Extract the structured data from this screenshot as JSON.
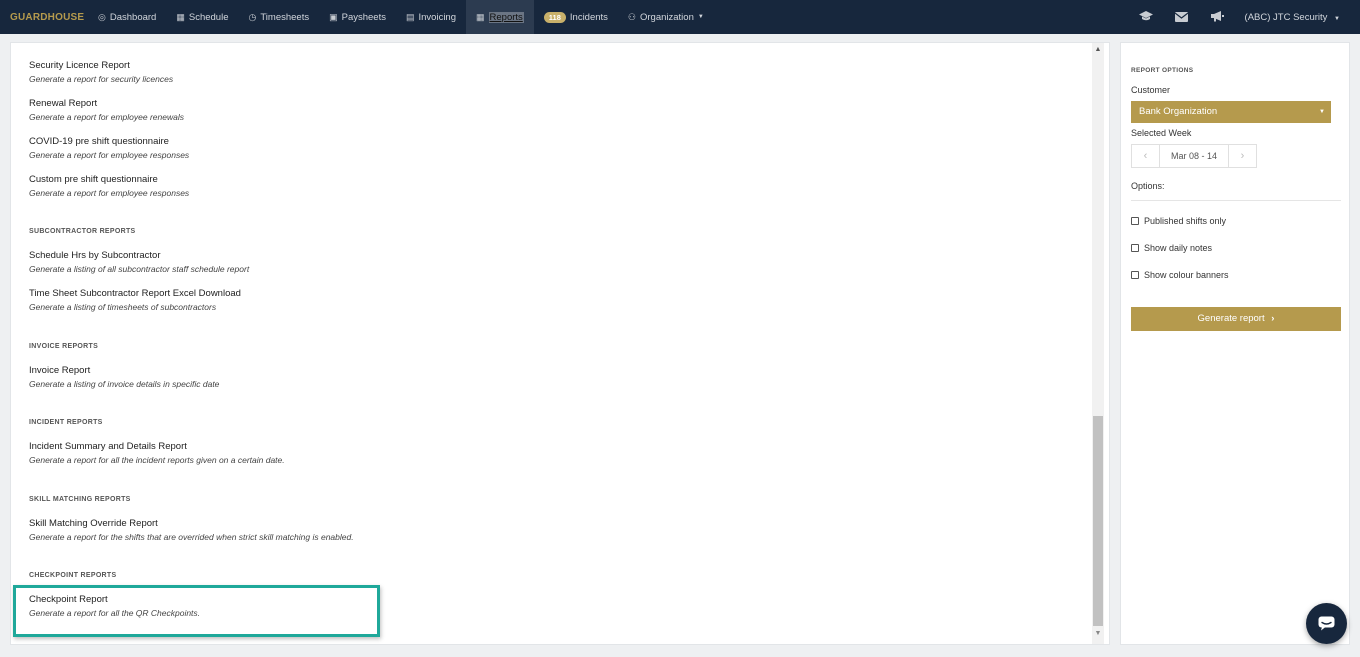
{
  "nav": {
    "brand": "GUARDHOUSE",
    "items": [
      {
        "label": "Dashboard",
        "icon": "dashboard-icon",
        "glyph": "◎"
      },
      {
        "label": "Schedule",
        "icon": "calendar-icon",
        "glyph": "▦"
      },
      {
        "label": "Timesheets",
        "icon": "clock-icon",
        "glyph": "◷"
      },
      {
        "label": "Paysheets",
        "icon": "money-icon",
        "glyph": "▣"
      },
      {
        "label": "Invoicing",
        "icon": "invoice-icon",
        "glyph": "▤"
      },
      {
        "label": "Reports",
        "icon": "table-icon",
        "glyph": "▦"
      },
      {
        "label": "Incidents",
        "badge": "118"
      },
      {
        "label": "Organization",
        "icon": "users-icon",
        "glyph": "⚇"
      }
    ],
    "right": {
      "icons": [
        "graduation-cap-icon",
        "envelope-icon",
        "megaphone-icon"
      ],
      "account": "(ABC) JTC Security"
    }
  },
  "reports": {
    "security_licence": {
      "title": "Security Licence Report",
      "desc": "Generate a report for security licences"
    },
    "renewal": {
      "title": "Renewal Report",
      "desc": "Generate a report for employee renewals"
    },
    "covid": {
      "title": "COVID-19 pre shift questionnaire",
      "desc": "Generate a report for employee responses"
    },
    "custom_questionnaire": {
      "title": "Custom pre shift questionnaire",
      "desc": "Generate a report for employee responses"
    },
    "subcontractor_head": "SUBCONTRACTOR REPORTS",
    "schedule_hrs": {
      "title": "Schedule Hrs by Subcontractor",
      "desc": "Generate a listing of all subcontractor staff schedule report"
    },
    "timesheet_sub": {
      "title": "Time Sheet Subcontractor Report Excel Download",
      "desc": "Generate a listing of timesheets of subcontractors"
    },
    "invoice_head": "INVOICE REPORTS",
    "invoice": {
      "title": "Invoice Report",
      "desc": "Generate a listing of invoice details in specific date"
    },
    "incident_head": "INCIDENT REPORTS",
    "incident": {
      "title": "Incident Summary and Details Report",
      "desc": "Generate a report for all the incident reports given on a certain date."
    },
    "skill_head": "SKILL MATCHING REPORTS",
    "skill": {
      "title": "Skill Matching Override Report",
      "desc": "Generate a report for the shifts that are overrided when strict skill matching is enabled."
    },
    "checkpoint_head": "CHECKPOINT REPORTS",
    "checkpoint": {
      "title": "Checkpoint Report",
      "desc": "Generate a report for all the QR Checkpoints."
    }
  },
  "options": {
    "heading": "REPORT OPTIONS",
    "customer_label": "Customer",
    "customer_value": "Bank Organization",
    "week_label": "Selected Week",
    "week_value": "Mar 08 - 14",
    "options_label": "Options:",
    "checkboxes": [
      {
        "label": "Published shifts only",
        "checked": false
      },
      {
        "label": "Show daily notes",
        "checked": false
      },
      {
        "label": "Show colour banners",
        "checked": false
      }
    ],
    "generate_label": "Generate report"
  },
  "colors": {
    "navbar": "#17273d",
    "accent_gold": "#b59a4d",
    "highlight_teal": "#1fa89a"
  }
}
